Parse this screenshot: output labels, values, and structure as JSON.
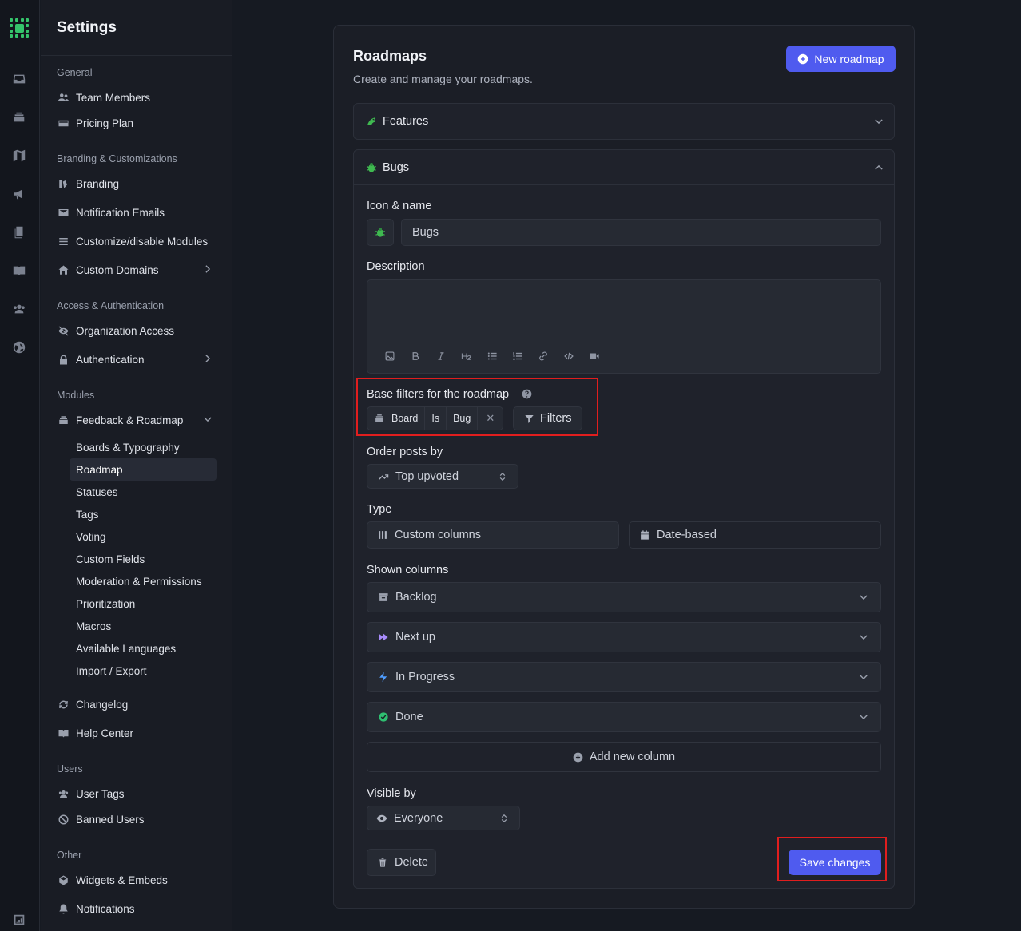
{
  "settings_title": "Settings",
  "sidebar": {
    "general_label": "General",
    "team_members": "Team Members",
    "pricing_plan": "Pricing Plan",
    "branding_section": "Branding & Customizations",
    "branding": "Branding",
    "notification_emails": "Notification Emails",
    "customize_modules": "Customize/disable Modules",
    "custom_domains": "Custom Domains",
    "access_section": "Access & Authentication",
    "organization_access": "Organization Access",
    "authentication": "Authentication",
    "modules_section": "Modules",
    "feedback_roadmap": "Feedback & Roadmap",
    "sub_items": [
      "Boards & Typography",
      "Roadmap",
      "Statuses",
      "Tags",
      "Voting",
      "Custom Fields",
      "Moderation & Permissions",
      "Prioritization",
      "Macros",
      "Available Languages",
      "Import / Export"
    ],
    "changelog": "Changelog",
    "help_center": "Help Center",
    "users_section": "Users",
    "user_tags": "User Tags",
    "banned_users": "Banned Users",
    "other_section": "Other",
    "widgets_embeds": "Widgets & Embeds",
    "notifications": "Notifications"
  },
  "main": {
    "title": "Roadmaps",
    "subtitle": "Create and manage your roadmaps.",
    "new_roadmap": "New roadmap",
    "features_label": "Features",
    "bugs_label": "Bugs",
    "icon_name_label": "Icon & name",
    "name_value": "Bugs",
    "description_label": "Description",
    "base_filters_label": "Base filters for the roadmap",
    "filter_field": "Board",
    "filter_op": "Is",
    "filter_value": "Bug",
    "filters_button": "Filters",
    "order_label": "Order posts by",
    "order_value": "Top upvoted",
    "type_label": "Type",
    "type_custom": "Custom columns",
    "type_date": "Date-based",
    "shown_columns_label": "Shown columns",
    "columns": [
      "Backlog",
      "Next up",
      "In Progress",
      "Done"
    ],
    "add_column": "Add new column",
    "visible_label": "Visible by",
    "visible_value": "Everyone",
    "delete": "Delete",
    "save": "Save changes"
  },
  "colors": {
    "accent": "#4f5bef",
    "highlight": "#e01e1e",
    "done_green": "#2fbf71",
    "next_up_purple": "#a78bfa",
    "in_progress_blue": "#4f9dff"
  }
}
